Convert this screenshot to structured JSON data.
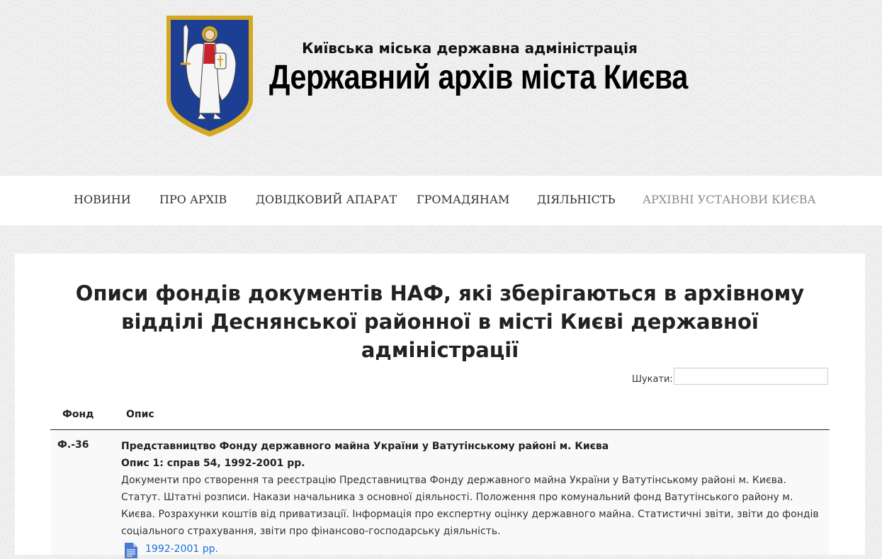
{
  "header": {
    "subtitle": "Київська міська державна адміністрація",
    "title": "Державний архів міста Києва"
  },
  "nav": {
    "items": [
      {
        "label": "НОВИНИ"
      },
      {
        "label": "ПРО АРХІВ"
      },
      {
        "label": "ДОВІДКОВИЙ АПАРАТ"
      },
      {
        "label": "ГРОМАДЯНАМ"
      },
      {
        "label": "ДІЯЛЬНІСТЬ"
      },
      {
        "label": "АРХІВНІ УСТАНОВИ КИЄВА"
      }
    ]
  },
  "page": {
    "title": "Описи фондів документів НАФ, які зберігаються в архівному відділі Деснянської районної в місті Києві державної адміністрації"
  },
  "search": {
    "label": "Шукати:",
    "value": ""
  },
  "table": {
    "headers": [
      "Фонд",
      "Опис"
    ],
    "rows": [
      {
        "fond": "Ф.-36",
        "org": "Представництво Фонду державного майна України у Ватутінському районі м. Києва",
        "opys": "Опис 1: справ 54, 1992-2001 рр.",
        "description": "Документи про створення та реєстрацію Представництва Фонду державного майна України у Ватутінському районі м. Києва. Статут. Штатні розписи. Накази начальника з основної діяльності. Положення про комунальний фонд Ватутінського району м. Києва. Розрахунки коштів від приватизації. Інформація про експертну оцінку державного майна. Статистичні звіти, звіти до фондів соціального страхування, звіти про фінансово-господарську діяльність.",
        "file_label": "1992-2001 рр."
      }
    ]
  },
  "colors": {
    "shield_blue": "#1c3f94",
    "shield_gold": "#d6a821",
    "link": "#1a6fd6"
  }
}
